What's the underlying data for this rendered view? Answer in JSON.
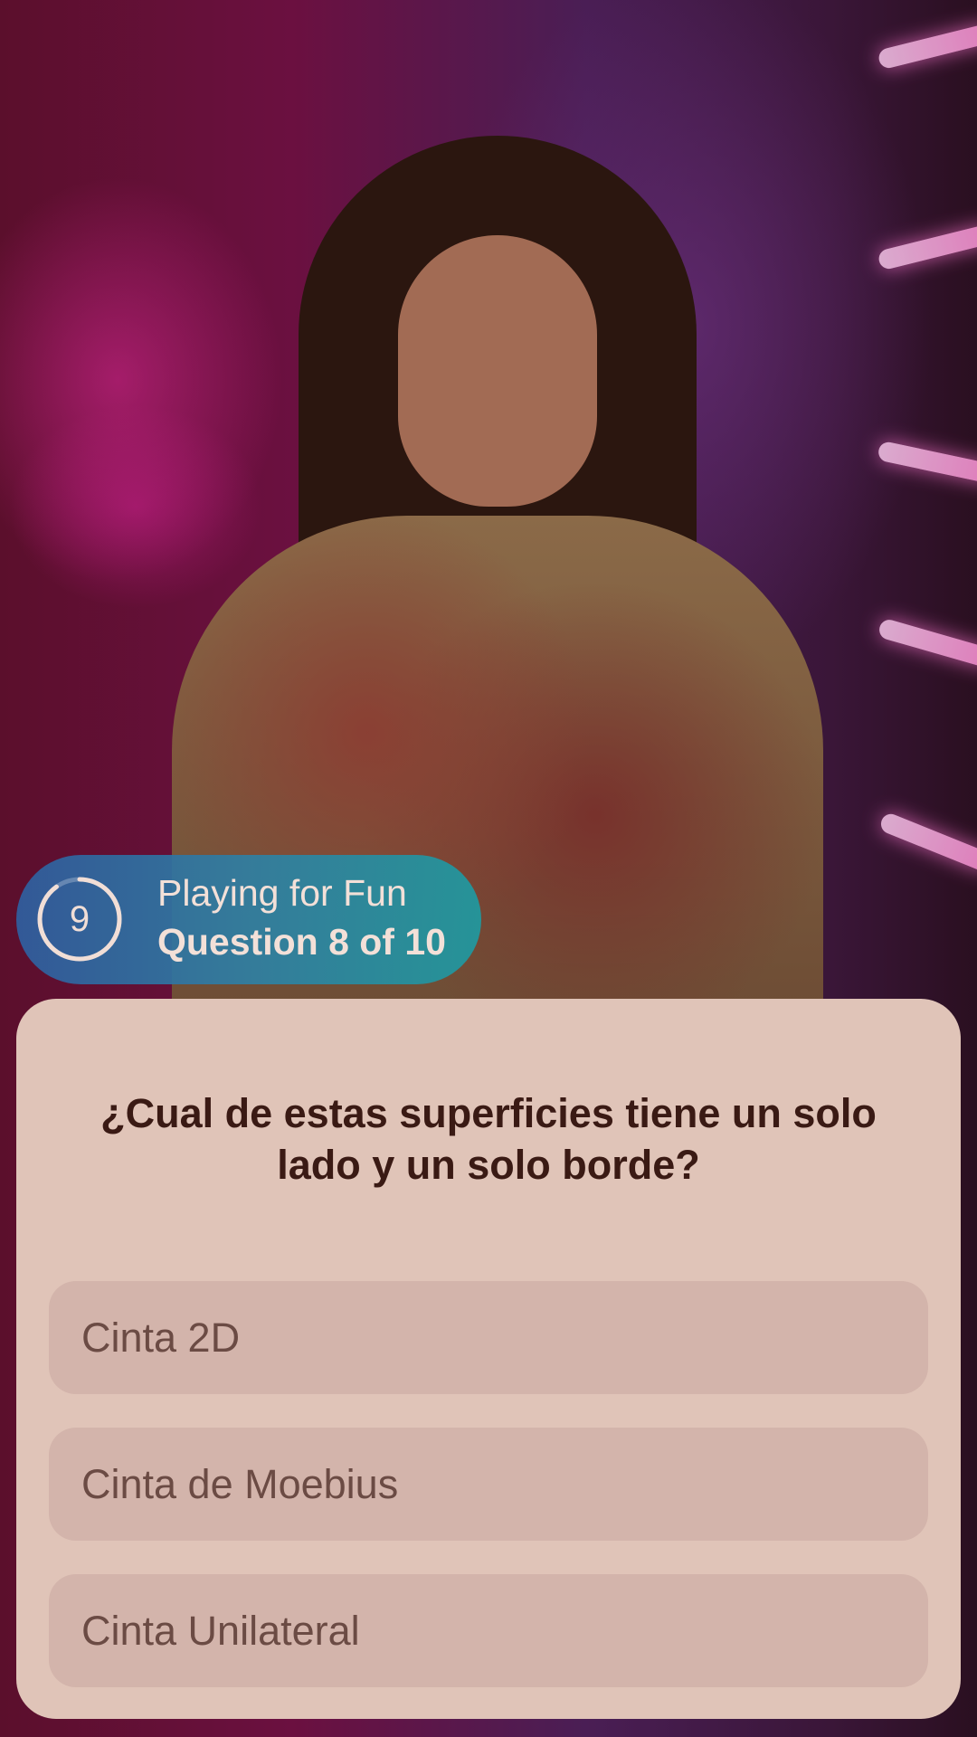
{
  "status": {
    "timer_value": "9",
    "timer_fraction_remaining": 0.9,
    "mode_label": "Playing for Fun",
    "progress_label": "Question 8 of 10"
  },
  "question": {
    "text": "¿Cual de estas superficies tiene un solo lado y un solo borde?"
  },
  "options": [
    {
      "label": "Cinta 2D"
    },
    {
      "label": "Cinta de Moebius"
    },
    {
      "label": "Cinta Unilateral"
    }
  ],
  "colors": {
    "card_background": "#e0c4b8",
    "option_background": "#d3b4ab",
    "pill_gradient_start": "#2f5fa0",
    "pill_gradient_end": "#1f9aa0",
    "question_text": "#3a1a14",
    "option_text": "#6b4b44"
  }
}
